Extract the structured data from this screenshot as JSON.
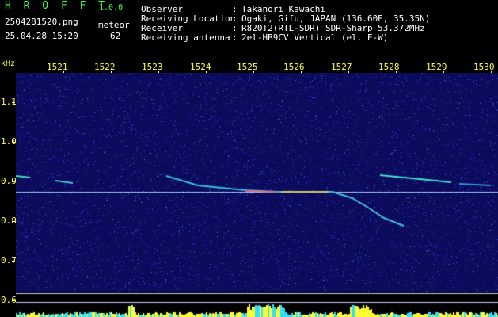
{
  "app": {
    "name": "H R O F F T",
    "version": "1.0.0"
  },
  "file": {
    "name": "2504281520.png",
    "datetime": "25.04.28 15:20"
  },
  "detection": {
    "label": "meteor",
    "count": "62"
  },
  "info": [
    {
      "key": "Observer",
      "sep": ":",
      "value": "Takanori Kawachi"
    },
    {
      "key": "Receiving Location",
      "sep": ":",
      "value": "Ogaki, Gifu, JAPAN (136.60E, 35.35N)"
    },
    {
      "key": "Receiver",
      "sep": ":",
      "value": "R820T2(RTL-SDR) SDR-Sharp 53.372MHz"
    },
    {
      "key": "Receiving antenna",
      "sep": ":",
      "value": "2el-HB9CV Vertical (el. E-W)"
    }
  ],
  "y_axis": {
    "unit": "kHz",
    "labels": [
      "1.1",
      "1.0",
      "0.9",
      "0.8",
      "0.7",
      "0.6"
    ]
  },
  "time_axis": {
    "labels": [
      "1521",
      "1522",
      "1523",
      "1524",
      "1525",
      "1526",
      "1527",
      "1528",
      "1529",
      "1530"
    ]
  },
  "colors": {
    "background": "#000000",
    "waterfall": "#0c0a5a",
    "axis_text": "#ffff40",
    "title": "#40ff40",
    "text": "#ffffff"
  }
}
